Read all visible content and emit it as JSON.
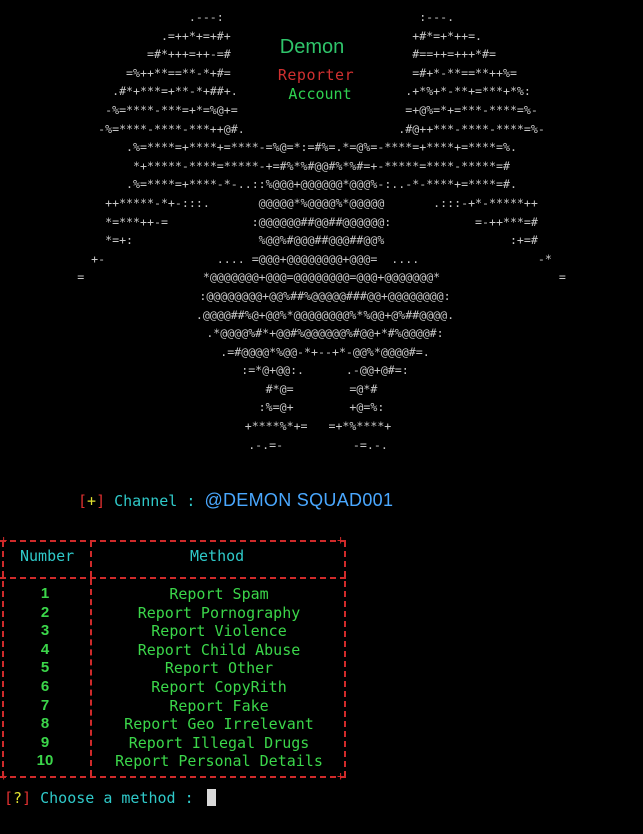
{
  "banner": {
    "ascii_lines": [
      "             .---:                            :---.             ",
      "          .=++*+=+#+                          +#*=+*++=.          ",
      "        =#*+++=++-=#                          #==++=+++*#=        ",
      "      =%++**==**-*+#=                          =#+*-**==**++%=      ",
      "     .#*+***=+**-*+##+.                        .+*%+*-**+=***+*%:     ",
      "    -%=****-***=+*=%@+=                        =+@%=*+=***-****=%-    ",
      "   -%=****-****-***++@#.                      .#@++***-****-****=%-   ",
      "  .%=****=+****+=****-=%@=*:=#%=.*=@%=-****=+****+=****=%.  ",
      "  *+*****-****=*****-+=#%*%#@@#%*%#=+-*****=****-*****=#  ",
      " .%=****=+****-*-..::%@@@+@@@@@@*@@@%-:..-*-****+=****=#. ",
      " ++*****-*+-:::.       @@@@@*%@@@@%*@@@@@       .:::-+*-*****++ ",
      " *=***++-=            :@@@@@@##@@##@@@@@@:            =-++***=# ",
      " *=+:                  %@@%#@@@##@@@##@@%                  :+=# ",
      " +-                .... =@@@+@@@@@@@@+@@@=  ....                 -* ",
      " =                 *@@@@@@@+@@@=@@@@@@@@=@@@+@@@@@@@*                 = ",
      "                  :@@@@@@@@+@@%##%@@@@@###@@+@@@@@@@@:                 ",
      "                  .@@@@##%@+@@%*@@@@@@@@%*%@@+@%##@@@@.                 ",
      "                   .*@@@@%#*+@@#%@@@@@@%#@@+*#%@@@@#:                  ",
      "                      .=#@@@@*%@@-*+--+*-@@%*@@@@#=.                     ",
      "                         :=*@+@@:.      .-@@+@#=:                        ",
      "                            #*@=        =@*#                            ",
      "                           :%=@+        +@=%:                           ",
      "                        +****%*+=   =+*%****+                         ",
      "                          .-.=-          -=.-.                           "
    ],
    "title": "Demon",
    "subtitle_1": "Reporter",
    "subtitle_2": "Account"
  },
  "channel": {
    "bracket_open": "[",
    "marker": "+",
    "bracket_close": "]",
    "label": " Channel : ",
    "handle": "@DEMON SQUAD001"
  },
  "menu": {
    "header_number": "Number",
    "header_method": "Method",
    "items": [
      {
        "number": "1",
        "method": "Report Spam"
      },
      {
        "number": "2",
        "method": "Report Pornography"
      },
      {
        "number": "3",
        "method": "Report Violence"
      },
      {
        "number": "4",
        "method": "Report Child Abuse"
      },
      {
        "number": "5",
        "method": "Report Other"
      },
      {
        "number": "6",
        "method": "Report CopyRith"
      },
      {
        "number": "7",
        "method": "Report Fake"
      },
      {
        "number": "8",
        "method": "Report Geo Irrelevant"
      },
      {
        "number": "9",
        "method": "Report Illegal Drugs"
      },
      {
        "number": "10",
        "method": "Report Personal Details"
      }
    ]
  },
  "prompt": {
    "bracket_open": "[",
    "marker": "?",
    "bracket_close": "]",
    "text": " Choose a method : "
  },
  "colors": {
    "background": "#000000",
    "ascii": "#c9c9c9",
    "title": "#2fc46a",
    "subtitle_1": "#d03030",
    "subtitle_2": "#2fd050",
    "label": "#2fc9c9",
    "handle": "#4aa8ff",
    "table_border": "#d02a2a",
    "menu_text": "#3bd64a",
    "bracket": "#e03030",
    "marker": "#e0e030"
  }
}
